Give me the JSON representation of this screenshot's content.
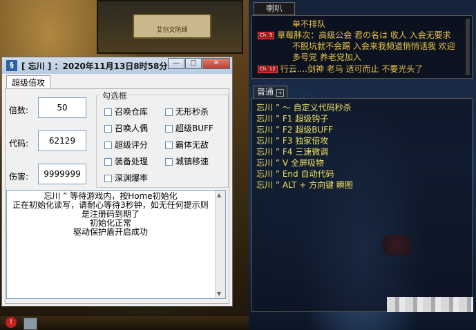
{
  "map": {
    "sign_text": "艾尔文防线"
  },
  "chat": {
    "tab_label": "喇叭",
    "lines": [
      {
        "badge": "",
        "text": "单不排队"
      },
      {
        "badge": "Ch. 9",
        "text": "草莓胖次：高级公会 君の名は 收人 入会无要求"
      },
      {
        "badge": "",
        "text": "不脱坑就不会踢 入会来我频道悄悄话我 欢迎"
      },
      {
        "badge": "",
        "text": "多号党 养老党加入"
      },
      {
        "badge": "Ch. 12",
        "text": "行云....剑神  老马  适可而止  不要光头了"
      }
    ]
  },
  "normal": {
    "tab_label": "普通",
    "plus": "+",
    "commands": [
      "忘川 ”  ～  自定义代码秒杀",
      "忘川 ” F1  超级钩子",
      "忘川 ” F2  超级BUFF",
      "忘川 ” F3  独家倍攻",
      "忘川 ” F4  三速微调",
      "忘川 ” V   全屏吸物",
      "忘川 ” End 自动代码",
      "忘川 ” ALT + 方向键 瞬图"
    ]
  },
  "window": {
    "app_icon": "§",
    "title": "[ 忘川 ] ：2020年11月13日8时58分...",
    "min_label": "—",
    "max_label": "□",
    "close_label": "✕",
    "tab_label": "超级倍攻",
    "fields": [
      {
        "label": "倍数:",
        "value": "50"
      },
      {
        "label": "代码:",
        "value": "62129"
      },
      {
        "label": "伤害:",
        "value": "9999999"
      }
    ],
    "group_title": "勾选框",
    "checkboxes": [
      "召唤仓库",
      "无形秒杀",
      "召唤人偶",
      "超级BUFF",
      "超级评分",
      "霸体无敌",
      "装备处理",
      "城镇移速",
      "深渊爆率"
    ],
    "log": [
      "忘川 ”  等待游戏内，按Home初始化",
      "正在初始化读写，请耐心等待3秒钟，如无任何提示则",
      "是注册码到期了",
      "初始化正常",
      "驱动保护盾开启成功"
    ]
  },
  "bottom": {
    "warn_icon_text": "!"
  }
}
